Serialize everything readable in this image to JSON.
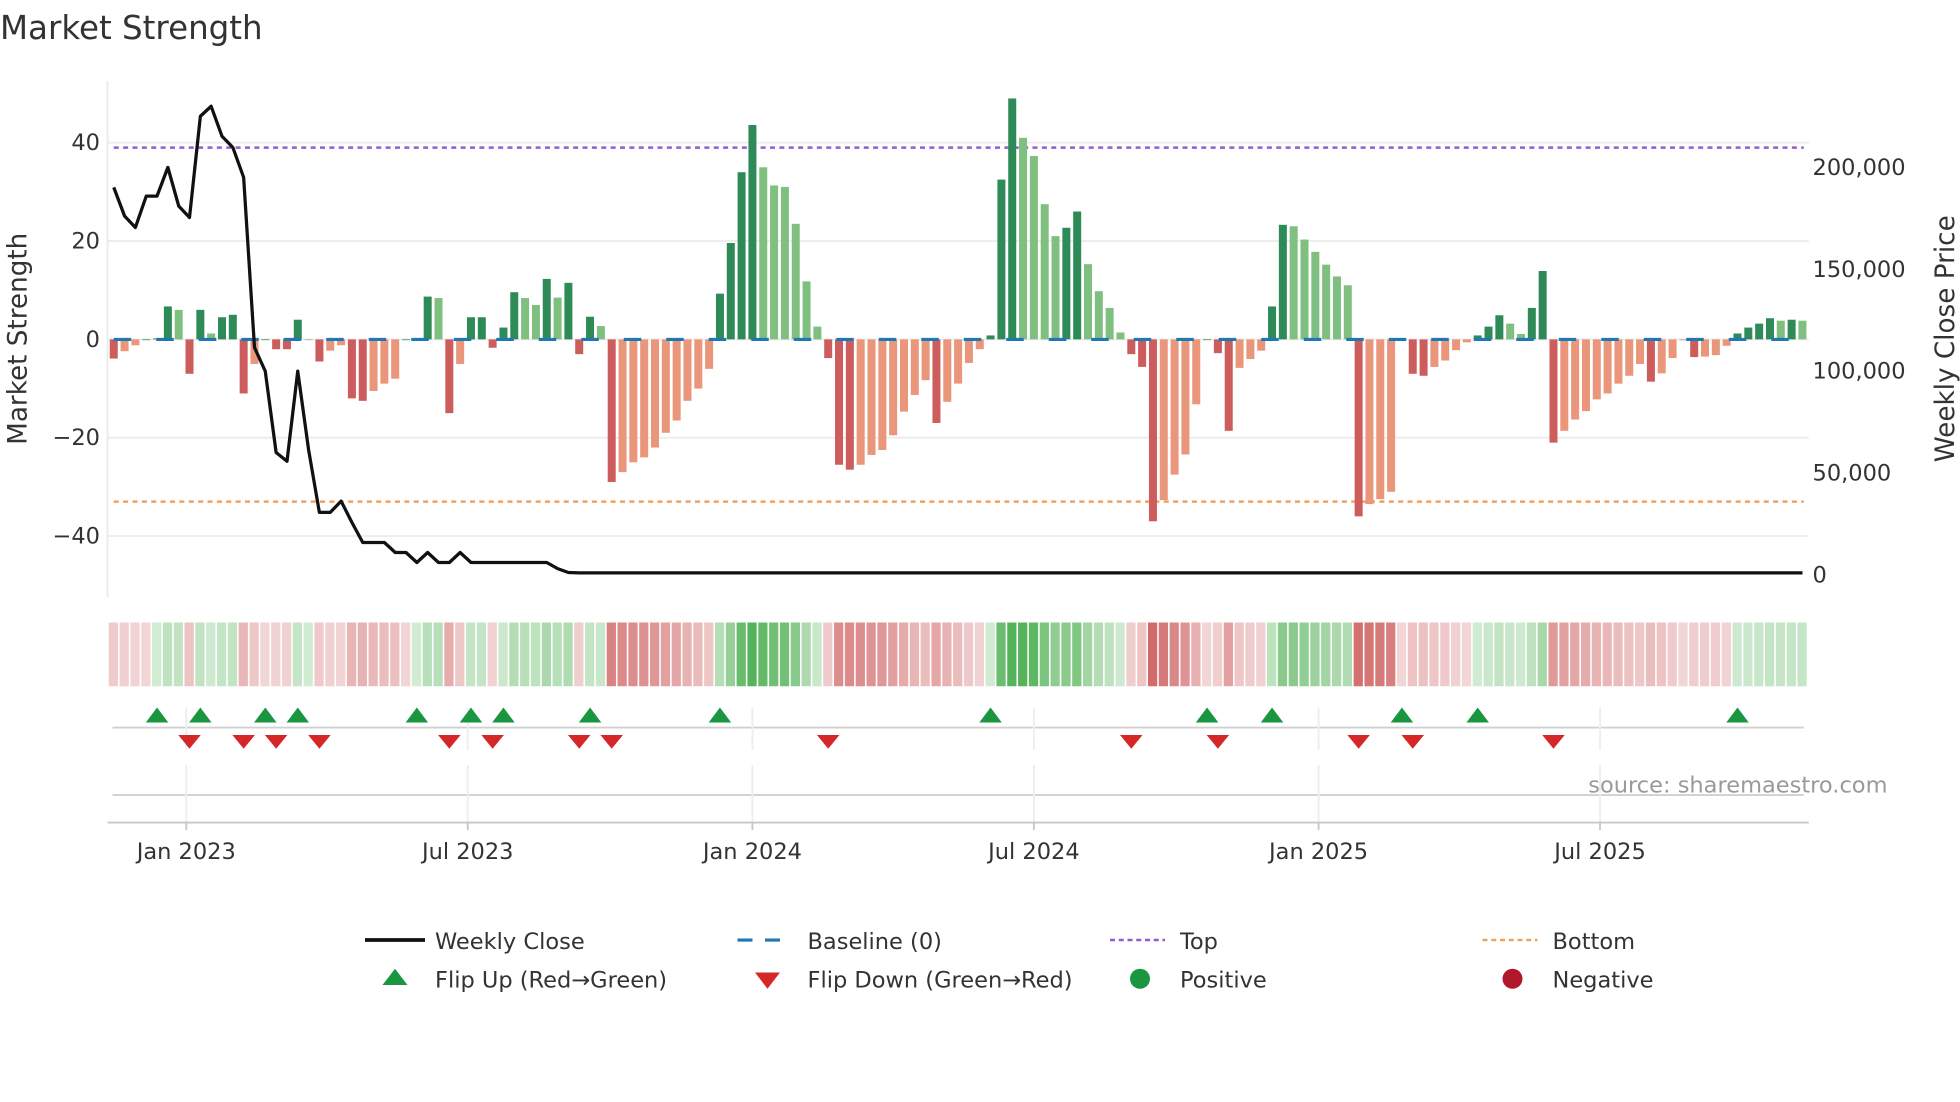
{
  "title": "Market Strength",
  "source": "source: sharemaestro.com",
  "colors": {
    "pos_strong": "#2e8b57",
    "pos_weak": "#7fbf7f",
    "neg_strong": "#cd5c5c",
    "neg_weak": "#e9967a",
    "close": "#111111",
    "baseline": "#1f77b4",
    "top": "#9b59d0",
    "bottom": "#f0a35e",
    "flip_up": "#1a9641",
    "flip_down": "#d62728",
    "positive": "#1a9641",
    "negative": "#b2182b"
  },
  "chart_data": {
    "type": "bar",
    "title": "Market Strength",
    "interval": "weekly",
    "ylabel": "Market Strength",
    "y2label": "Weekly Close Price",
    "ylim": [
      -52.5,
      52.5
    ],
    "y2lim": [
      -11700,
      241700
    ],
    "y_ticks": [
      "40",
      "20",
      "0",
      "−20",
      "−40"
    ],
    "y_tick_values": [
      40,
      20,
      0,
      -20,
      -40
    ],
    "y2_ticks": [
      "200,000",
      "150,000",
      "100,000",
      "50,000",
      "0"
    ],
    "y2_tick_values": [
      200000,
      150000,
      100000,
      50000,
      0
    ],
    "x_ticks": [
      {
        "label": "Jan 2023",
        "week": 6.7
      },
      {
        "label": "Jul 2023",
        "week": 32.7
      },
      {
        "label": "Jan 2024",
        "week": 59
      },
      {
        "label": "Jul 2024",
        "week": 85
      },
      {
        "label": "Jan 2025",
        "week": 111.3
      },
      {
        "label": "Jul 2025",
        "week": 137.3
      }
    ],
    "top_level": 39,
    "bottom_level": -33,
    "baseline": 0,
    "strength": [
      -3.9,
      -2.4,
      -1.2,
      0,
      0.2,
      6.7,
      6,
      -7,
      6,
      1.2,
      4.5,
      5,
      -11,
      -5,
      0,
      -2,
      -2,
      4,
      0,
      -4.5,
      -2.3,
      -1.2,
      -12,
      -12.5,
      -10.5,
      -9,
      -8,
      0,
      0.2,
      8.7,
      8.4,
      -15,
      -5,
      4.5,
      4.5,
      -1.7,
      2.4,
      9.6,
      8.4,
      7,
      12.3,
      8.5,
      11.5,
      -3,
      4.6,
      2.7,
      -29,
      -27,
      -25,
      -24,
      -22,
      -19,
      -16.5,
      -12.5,
      -10,
      -6,
      9.3,
      19.6,
      34,
      43.6,
      35,
      31.3,
      31,
      23.5,
      11.8,
      2.6,
      -3.8,
      -25.5,
      -26.5,
      -25.5,
      -23.5,
      -22.5,
      -19.5,
      -14.7,
      -11.3,
      -8.3,
      -17,
      -12.7,
      -9,
      -4.8,
      -2,
      0.8,
      32.5,
      49,
      41,
      37.3,
      27.5,
      21,
      22.7,
      26,
      15.3,
      9.8,
      6.4,
      1.4,
      -3,
      -5.6,
      -37,
      -32.7,
      -27.5,
      -23.4,
      -13.2,
      0,
      -2.8,
      -18.6,
      -5.8,
      -4,
      -2.3,
      6.7,
      23.3,
      23,
      20.3,
      17.8,
      15.2,
      12.8,
      11,
      -36,
      -33.5,
      -32.5,
      -31,
      0,
      -7,
      -7.4,
      -5.6,
      -4.3,
      -2.2,
      -0.6,
      0.8,
      2.6,
      4.9,
      3.2,
      1.1,
      6.4,
      13.9,
      -21,
      -18.6,
      -16.3,
      -14.6,
      -12.2,
      -11,
      -9,
      -7.4,
      -5,
      -8.6,
      -6.9,
      -3.8,
      -0.2,
      -3.6,
      -3.5,
      -3.2,
      -1.3,
      1.2,
      2.4,
      3.2,
      4.3,
      3.8,
      4,
      3.8
    ],
    "weekly_close": [
      189600,
      175500,
      169900,
      185300,
      185300,
      199400,
      180400,
      174800,
      224500,
      229400,
      214700,
      209200,
      194500,
      111000,
      99400,
      59500,
      55200,
      99400,
      60700,
      30100,
      30100,
      35600,
      25200,
      15300,
      15300,
      15300,
      10400,
      10400,
      5500,
      10400,
      5500,
      5500,
      10400,
      5500,
      5500,
      5500,
      5500,
      5500,
      5500,
      5500,
      5500,
      2500,
      600
    ],
    "weekly_close_tail_value": 400,
    "flip_up_weeks": [
      4,
      8,
      14,
      17,
      28,
      33,
      36,
      44,
      56,
      81,
      101,
      107,
      119,
      126,
      150
    ],
    "flip_down_weeks": [
      7,
      12,
      15,
      19,
      31,
      35,
      43,
      46,
      66,
      94,
      102,
      115,
      120,
      133
    ],
    "legend": [
      {
        "label": "Weekly Close",
        "type": "line"
      },
      {
        "label": "Baseline (0)",
        "type": "dashed"
      },
      {
        "label": "Top",
        "type": "dotted"
      },
      {
        "label": "Bottom",
        "type": "dotted"
      },
      {
        "label": "Flip Up (Red→Green)",
        "type": "triangle-up"
      },
      {
        "label": "Flip Down (Green→Red)",
        "type": "triangle-down"
      },
      {
        "label": "Positive",
        "type": "circle"
      },
      {
        "label": "Negative",
        "type": "circle"
      }
    ],
    "legend_position": "bottom"
  }
}
